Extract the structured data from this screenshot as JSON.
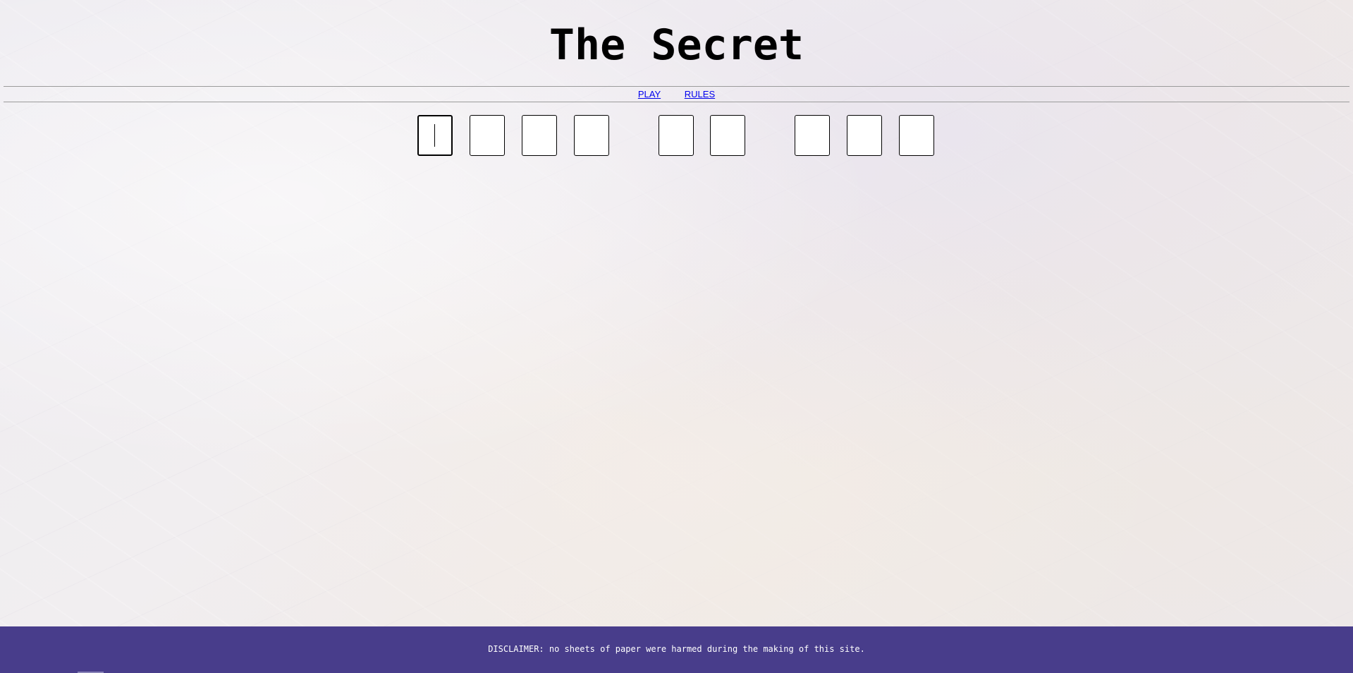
{
  "header": {
    "title": "The Secret"
  },
  "nav": {
    "items": [
      {
        "label": "PLAY"
      },
      {
        "label": "RULES"
      }
    ]
  },
  "puzzle": {
    "word_lengths": [
      4,
      2,
      3
    ],
    "letters": [
      "",
      "",
      "",
      "",
      "",
      "",
      "",
      "",
      ""
    ]
  },
  "footer": {
    "text": "DISCLAIMER: no sheets of paper were harmed during the making of this site."
  },
  "colors": {
    "footer_bg": "#483d8b",
    "link": "#0000ee"
  }
}
